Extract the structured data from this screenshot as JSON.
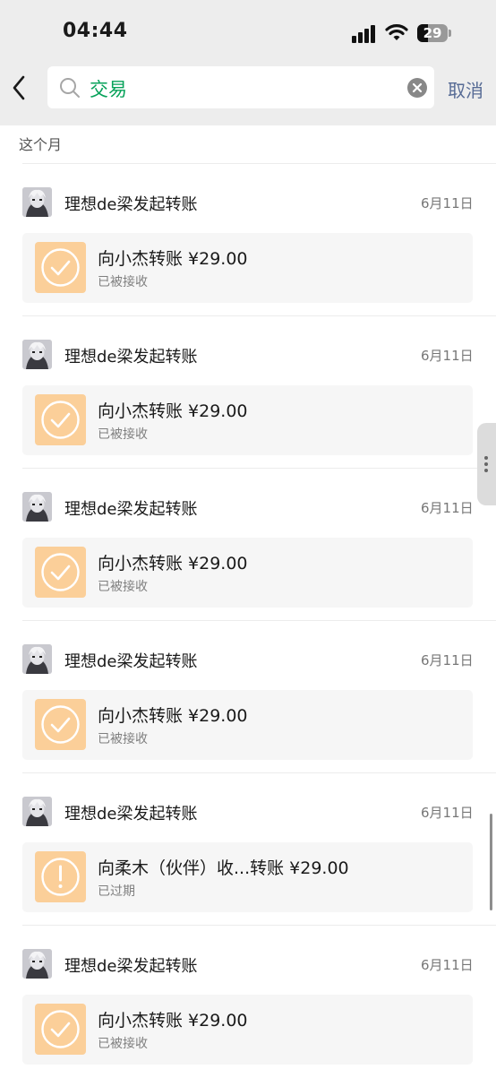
{
  "status_bar": {
    "time": "04:44",
    "battery": "29"
  },
  "search": {
    "query": "交易",
    "cancel_label": "取消"
  },
  "month_header": "这个月",
  "entries": [
    {
      "title": "理想de梁发起转账",
      "date": "6月11日",
      "card_title": "向小杰转账 ¥29.00",
      "card_status": "已被接收",
      "state": "received"
    },
    {
      "title": "理想de梁发起转账",
      "date": "6月11日",
      "card_title": "向小杰转账 ¥29.00",
      "card_status": "已被接收",
      "state": "received"
    },
    {
      "title": "理想de梁发起转账",
      "date": "6月11日",
      "card_title": "向小杰转账 ¥29.00",
      "card_status": "已被接收",
      "state": "received"
    },
    {
      "title": "理想de梁发起转账",
      "date": "6月11日",
      "card_title": "向小杰转账 ¥29.00",
      "card_status": "已被接收",
      "state": "received"
    },
    {
      "title": "理想de梁发起转账",
      "date": "6月11日",
      "card_title": "向柔木（伙伴）收...转账 ¥29.00",
      "card_status": "已过期",
      "state": "expired"
    },
    {
      "title": "理想de梁发起转账",
      "date": "6月11日",
      "card_title": "向小杰转账 ¥29.00",
      "card_status": "已被接收",
      "state": "received"
    }
  ],
  "colors": {
    "accent_green": "#07a25a",
    "link_blue": "#576b95",
    "transfer_orange": "#fbcf99"
  }
}
